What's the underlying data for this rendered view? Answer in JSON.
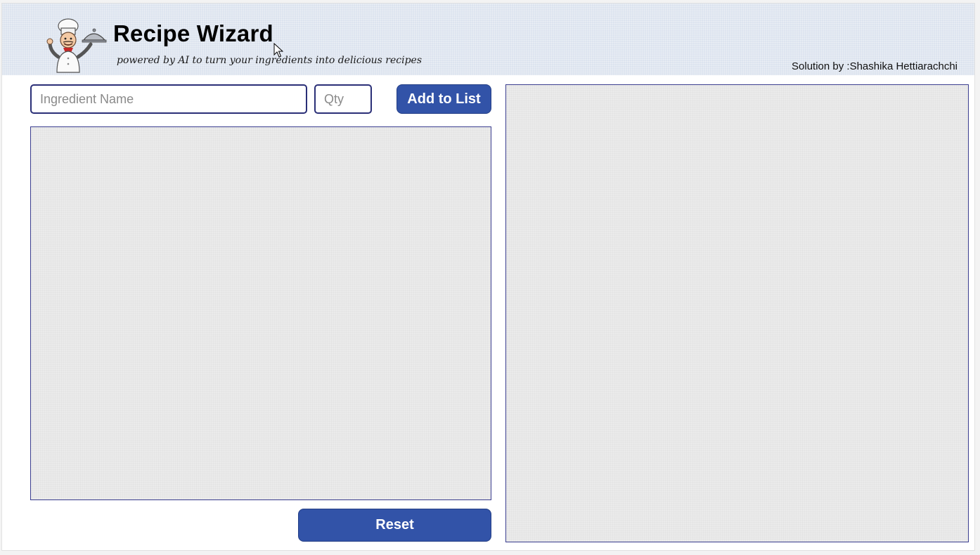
{
  "header": {
    "title": "Recipe Wizard",
    "subtitle": "powered by AI to turn your ingredients into delicious recipes",
    "credit": "Solution by :Shashika Hettiarachchi",
    "logo_icon": "chef-icon"
  },
  "form": {
    "ingredient_placeholder": "Ingredient Name",
    "ingredient_value": "",
    "qty_placeholder": "Qty",
    "qty_value": "",
    "add_label": "Add to List",
    "reset_label": "Reset"
  },
  "ingredients": [],
  "recipe": "",
  "colors": {
    "header_bg": "#dce3ef",
    "button_bg": "#3253a8",
    "input_border": "#2a2f77",
    "panel_bg": "#ebebeb"
  }
}
